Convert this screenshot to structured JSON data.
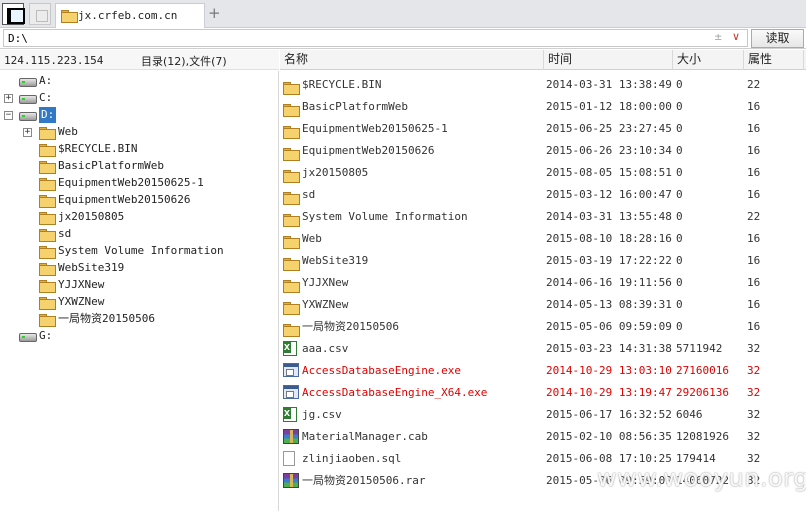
{
  "tab": {
    "title": "jx.crfeb.com.cn"
  },
  "address": {
    "path": "D:\\",
    "read_label": "读取",
    "tool_glyph": "±"
  },
  "info": {
    "ip": "124.115.223.154",
    "summary": "目录(12),文件(7)"
  },
  "tree": {
    "drives": [
      {
        "label": "A:",
        "expander": ""
      },
      {
        "label": "C:",
        "expander": "+"
      },
      {
        "label": "D:",
        "expander": "-",
        "selected": true
      },
      {
        "label": "G:",
        "expander": ""
      }
    ],
    "d_children": [
      {
        "label": "Web",
        "expander": "+"
      },
      {
        "label": "$RECYCLE.BIN"
      },
      {
        "label": "BasicPlatformWeb"
      },
      {
        "label": "EquipmentWeb20150625-1"
      },
      {
        "label": "EquipmentWeb20150626"
      },
      {
        "label": "jx20150805"
      },
      {
        "label": "sd"
      },
      {
        "label": "System Volume Information"
      },
      {
        "label": "WebSite319"
      },
      {
        "label": "YJJXNew"
      },
      {
        "label": "YXWZNew"
      },
      {
        "label": "一局物资20150506"
      }
    ]
  },
  "list": {
    "headers": {
      "name": "名称",
      "time": "时间",
      "size": "大小",
      "attr": "属性"
    },
    "rows": [
      {
        "icon": "folder",
        "name": "$RECYCLE.BIN",
        "time": "2014-03-31 13:38:49",
        "size": "0",
        "attr": "22"
      },
      {
        "icon": "folder",
        "name": "BasicPlatformWeb",
        "time": "2015-01-12 18:00:00",
        "size": "0",
        "attr": "16"
      },
      {
        "icon": "folder",
        "name": "EquipmentWeb20150625-1",
        "time": "2015-06-25 23:27:45",
        "size": "0",
        "attr": "16"
      },
      {
        "icon": "folder",
        "name": "EquipmentWeb20150626",
        "time": "2015-06-26 23:10:34",
        "size": "0",
        "attr": "16"
      },
      {
        "icon": "folder",
        "name": "jx20150805",
        "time": "2015-08-05 15:08:51",
        "size": "0",
        "attr": "16"
      },
      {
        "icon": "folder",
        "name": "sd",
        "time": "2015-03-12 16:00:47",
        "size": "0",
        "attr": "16"
      },
      {
        "icon": "folder",
        "name": "System Volume Information",
        "time": "2014-03-31 13:55:48",
        "size": "0",
        "attr": "22"
      },
      {
        "icon": "folder",
        "name": "Web",
        "time": "2015-08-10 18:28:16",
        "size": "0",
        "attr": "16"
      },
      {
        "icon": "folder",
        "name": "WebSite319",
        "time": "2015-03-19 17:22:22",
        "size": "0",
        "attr": "16"
      },
      {
        "icon": "folder",
        "name": "YJJXNew",
        "time": "2014-06-16 19:11:56",
        "size": "0",
        "attr": "16"
      },
      {
        "icon": "folder",
        "name": "YXWZNew",
        "time": "2014-05-13 08:39:31",
        "size": "0",
        "attr": "16"
      },
      {
        "icon": "folder",
        "name": "一局物资20150506",
        "time": "2015-05-06 09:59:09",
        "size": "0",
        "attr": "16"
      },
      {
        "icon": "csv",
        "name": "aaa.csv",
        "time": "2015-03-23 14:31:38",
        "size": "5711942",
        "attr": "32"
      },
      {
        "icon": "exe",
        "name": "AccessDatabaseEngine.exe",
        "time": "2014-10-29 13:03:10",
        "size": "27160016",
        "attr": "32",
        "highlight": true
      },
      {
        "icon": "exe",
        "name": "AccessDatabaseEngine_X64.exe",
        "time": "2014-10-29 13:19:47",
        "size": "29206136",
        "attr": "32",
        "highlight": true
      },
      {
        "icon": "csv",
        "name": "jg.csv",
        "time": "2015-06-17 16:32:52",
        "size": "6046",
        "attr": "32"
      },
      {
        "icon": "rar",
        "name": "MaterialManager.cab",
        "time": "2015-02-10 08:56:35",
        "size": "12081926",
        "attr": "32"
      },
      {
        "icon": "sql",
        "name": "zlinjiaoben.sql",
        "time": "2015-06-08 17:10:25",
        "size": "179414",
        "attr": "32"
      },
      {
        "icon": "rar",
        "name": "一局物资20150506.rar",
        "time": "2015-05-06 09:59:09",
        "size": "14060722",
        "attr": "32"
      }
    ]
  },
  "watermark": "www.wooyun.org",
  "colors": {
    "highlight": "#e00000",
    "selection": "#3178c6",
    "folder": "#f5d26e"
  }
}
